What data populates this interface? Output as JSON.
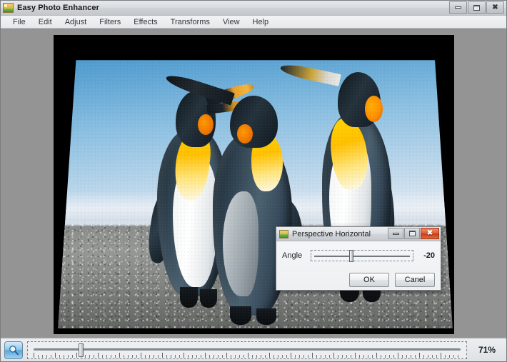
{
  "window": {
    "title": "Easy Photo Enhancer",
    "icon": "photo-app-icon",
    "buttons": {
      "minimize": "minimize-icon",
      "maximize": "maximize-icon",
      "close": "close-icon",
      "close_glyph": "✖"
    }
  },
  "menu": {
    "items": [
      {
        "label": "File"
      },
      {
        "label": "Edit"
      },
      {
        "label": "Adjust"
      },
      {
        "label": "Filters"
      },
      {
        "label": "Effects"
      },
      {
        "label": "Transforms"
      },
      {
        "label": "View"
      },
      {
        "label": "Help"
      }
    ]
  },
  "canvas": {
    "background_color": "#000000",
    "workspace_color": "#949494",
    "photo_description": "Three king penguins standing on a gray pebble beach with a blue sky, shown with a horizontal perspective skew"
  },
  "status_bar": {
    "zoom_icon": "magnifier-icon",
    "zoom_value": "71%",
    "zoom_slider_position_percent": 11.5
  },
  "dialog": {
    "title": "Perspective Horizontal",
    "icon": "photo-app-icon",
    "buttons": {
      "minimize": "minimize-icon",
      "maximize": "maximize-icon",
      "close": "close-icon",
      "close_glyph": "✖"
    },
    "angle": {
      "label": "Angle",
      "value": "-20",
      "slider_position_percent": 37
    },
    "ok_label": "OK",
    "cancel_label": "Canel"
  }
}
